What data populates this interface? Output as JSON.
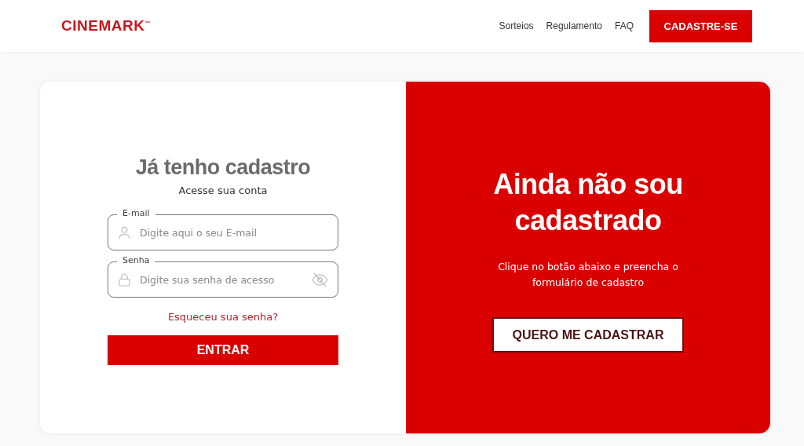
{
  "header": {
    "logo": "CINEMARK$^{™}$",
    "nav": [
      "Sorteios",
      "Regulamento",
      "FAQ"
    ],
    "button": "CADASTRE-SE"
  },
  "login": {
    "title": "Já tenho cadastro",
    "subtitle": "Acesse sua conta",
    "fields": [
      {
        "kind": "email",
        "label": "E-mail",
        "placeholder": "Digite aqui o seu E-mail"
      },
      {
        "kind": "password",
        "label": "Senha",
        "placeholder": "Digite sua senha de acesso"
      }
    ],
    "forgot": "Esqueceu sua senha?",
    "button": "ENTRAR"
  },
  "signup": {
    "title": "Ainda não sou cadastrado",
    "text": "Clique no botão abaixo e preencha o formulário de cadastro",
    "button": "QUERO ME CADASTRAR"
  }
}
